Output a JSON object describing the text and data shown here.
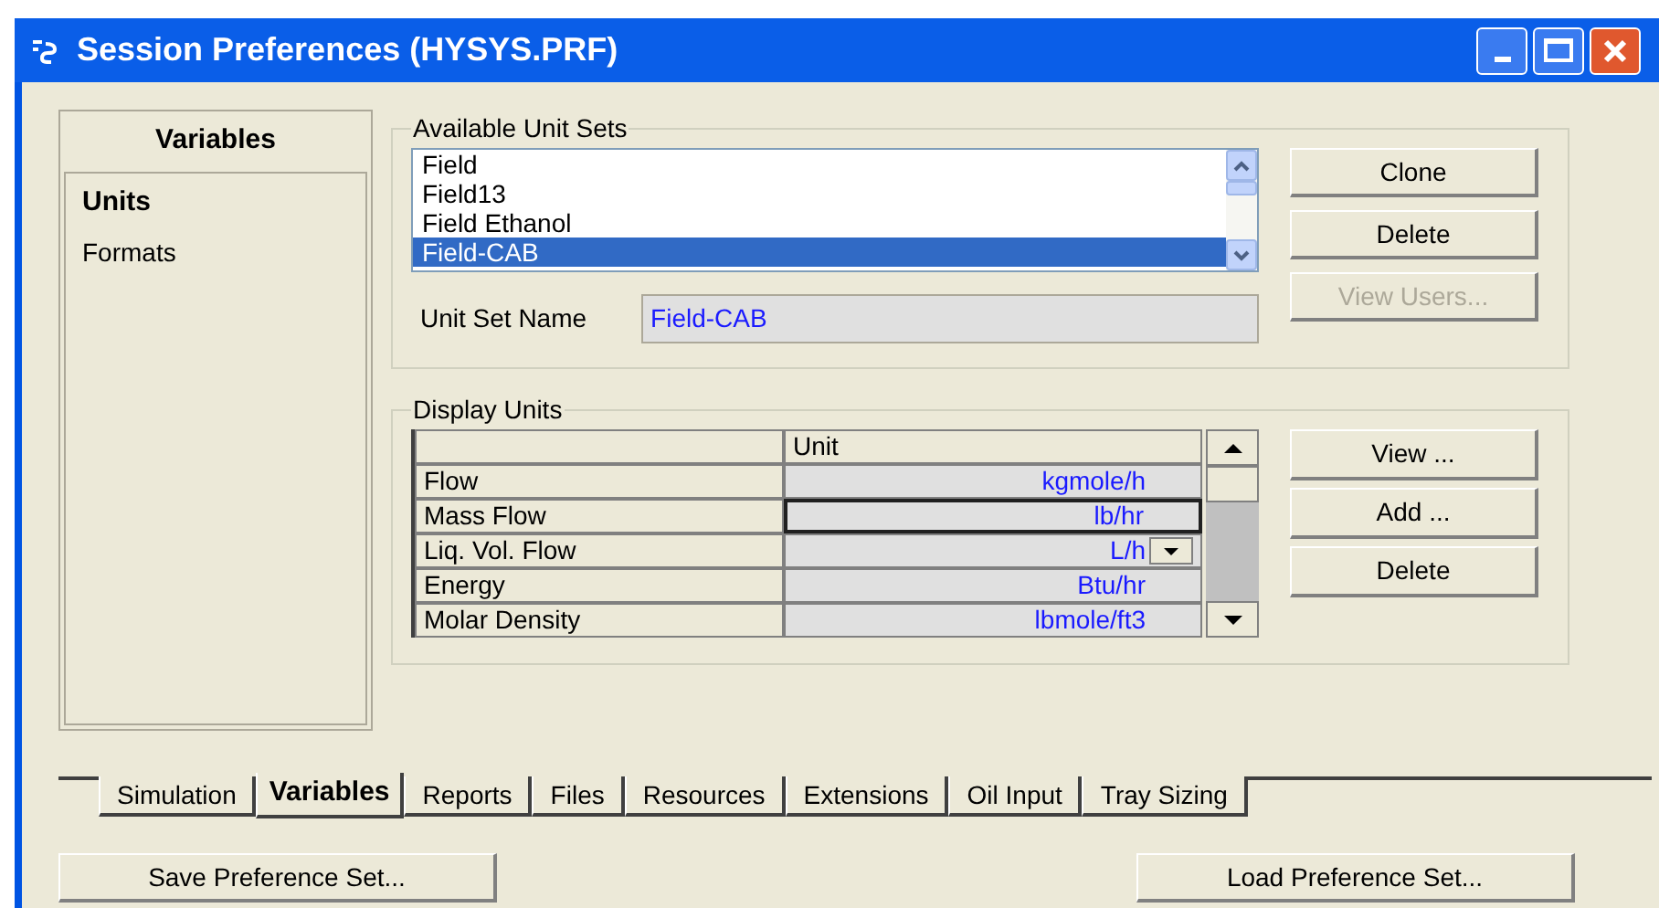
{
  "window": {
    "title": "Session Preferences (HYSYS.PRF)"
  },
  "sidebar": {
    "title": "Variables",
    "items": [
      {
        "label": "Units",
        "selected": true
      },
      {
        "label": "Formats",
        "selected": false
      }
    ]
  },
  "available_unit_sets": {
    "title": "Available Unit Sets",
    "items": [
      {
        "label": "Field",
        "selected": false
      },
      {
        "label": "Field13",
        "selected": false
      },
      {
        "label": "Field Ethanol",
        "selected": false
      },
      {
        "label": "Field-CAB",
        "selected": true
      }
    ],
    "buttons": [
      {
        "label": "Clone",
        "disabled": false
      },
      {
        "label": "Delete",
        "disabled": false
      },
      {
        "label": "View Users...",
        "disabled": true
      }
    ],
    "name_label": "Unit Set Name",
    "name_value": "Field-CAB"
  },
  "display_units": {
    "title": "Display Units",
    "column": "Unit",
    "rows": [
      {
        "variable": "Flow",
        "unit": "kgmole/h",
        "selected": false,
        "dropdown": false
      },
      {
        "variable": "Mass Flow",
        "unit": "lb/hr",
        "selected": true,
        "dropdown": false
      },
      {
        "variable": "Liq. Vol. Flow",
        "unit": "L/h",
        "selected": false,
        "dropdown": true
      },
      {
        "variable": "Energy",
        "unit": "Btu/hr",
        "selected": false,
        "dropdown": false
      },
      {
        "variable": "Molar Density",
        "unit": "lbmole/ft3",
        "selected": false,
        "dropdown": false
      }
    ],
    "buttons": [
      {
        "label": "View ..."
      },
      {
        "label": "Add ..."
      },
      {
        "label": "Delete"
      }
    ]
  },
  "tabs": [
    {
      "label": "Simulation",
      "selected": false
    },
    {
      "label": "Variables",
      "selected": true
    },
    {
      "label": "Reports",
      "selected": false
    },
    {
      "label": "Files",
      "selected": false
    },
    {
      "label": "Resources",
      "selected": false
    },
    {
      "label": "Extensions",
      "selected": false
    },
    {
      "label": "Oil Input",
      "selected": false
    },
    {
      "label": "Tray Sizing",
      "selected": false
    }
  ],
  "footer_buttons": [
    "Save Preference Set...",
    "Load Preference Set..."
  ]
}
